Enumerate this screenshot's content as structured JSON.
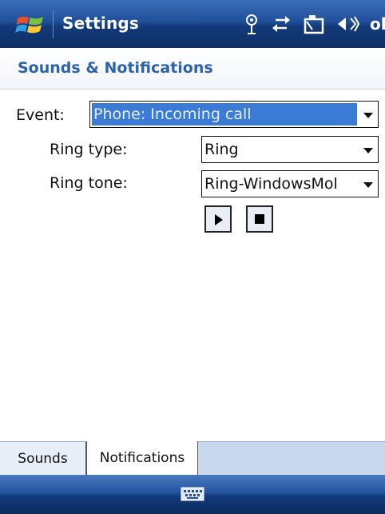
{
  "titlebar": {
    "title": "Settings",
    "ok_label": "ok"
  },
  "page": {
    "heading": "Sounds & Notifications"
  },
  "form": {
    "event_label": "Event:",
    "event_value": "Phone: Incoming call",
    "ring_type_label": "Ring type:",
    "ring_type_value": "Ring",
    "ring_tone_label": "Ring tone:",
    "ring_tone_value": "Ring-WindowsMol"
  },
  "tabs": [
    {
      "label": "Sounds",
      "active": false
    },
    {
      "label": "Notifications",
      "active": true
    }
  ],
  "colors": {
    "accent": "#2d62ad",
    "selection": "#3a7bd5",
    "bar_dark": "#123a7a"
  },
  "icons": {
    "start": "windows-flag-icon",
    "antenna": "antenna-icon",
    "sync": "sync-arrows-icon",
    "battery": "battery-icon",
    "volume": "speaker-icon",
    "keyboard": "keyboard-icon",
    "play": "play-icon",
    "stop": "stop-icon"
  }
}
